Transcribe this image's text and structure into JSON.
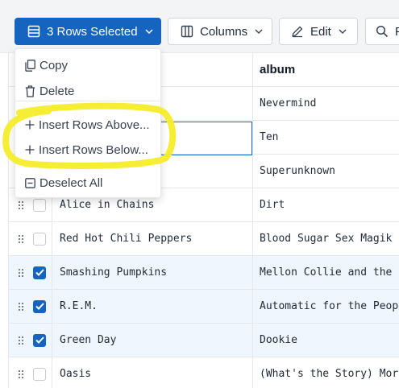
{
  "toolbar": {
    "rows_selected_label": "3 Rows Selected",
    "columns_label": "Columns",
    "edit_label": "Edit",
    "search_label": "F",
    "accent": "#1565c0"
  },
  "menu": {
    "items": [
      {
        "label": "Copy",
        "icon": "copy-icon"
      },
      {
        "label": "Delete",
        "icon": "trash-icon"
      },
      {
        "label": "Insert Rows Above...",
        "icon": "plus-icon"
      },
      {
        "label": "Insert Rows Below...",
        "icon": "plus-icon"
      },
      {
        "label": "Deselect All",
        "icon": "minus-square-icon"
      }
    ]
  },
  "table": {
    "columns": [
      "",
      "album"
    ],
    "rows": [
      {
        "artist": "",
        "album": "Nevermind",
        "selected": false
      },
      {
        "artist": "",
        "album": "Ten",
        "selected": false
      },
      {
        "artist": "",
        "album": "Superunknown",
        "selected": false
      },
      {
        "artist": "Alice in Chains",
        "album": "Dirt",
        "selected": false
      },
      {
        "artist": "Red Hot Chili Peppers",
        "album": "Blood Sugar Sex Magik",
        "selected": false
      },
      {
        "artist": "Smashing Pumpkins",
        "album": "Mellon Collie and the I",
        "selected": true
      },
      {
        "artist": "R.E.M.",
        "album": "Automatic for the People",
        "selected": true
      },
      {
        "artist": "Green Day",
        "album": "Dookie",
        "selected": true
      },
      {
        "artist": "Oasis",
        "album": "(What's the Story) Morn",
        "selected": false
      }
    ]
  },
  "annotation": {
    "color": "#f5ec2a"
  }
}
